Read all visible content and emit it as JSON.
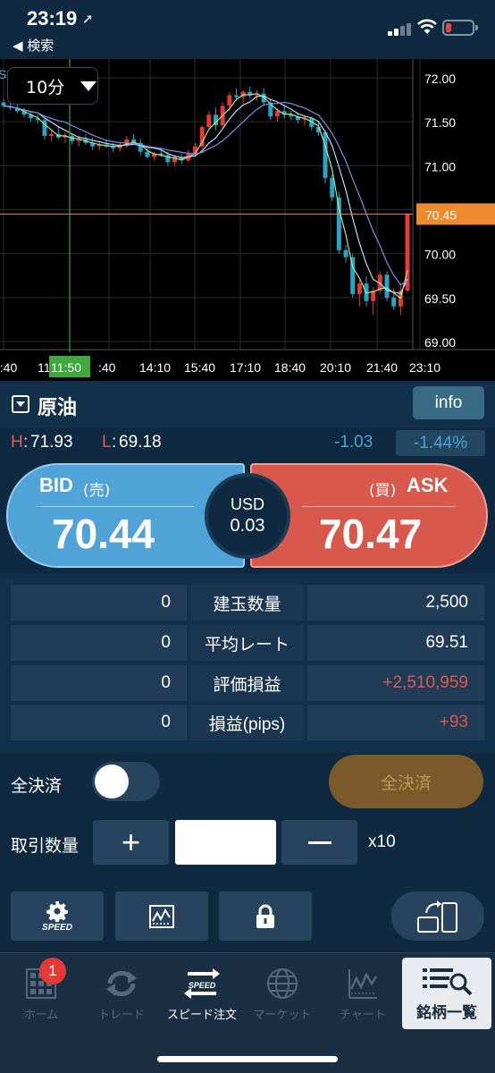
{
  "status_bar": {
    "time": "23:19",
    "back_label": "◀ 検索"
  },
  "chart": {
    "interval": "10分",
    "sma_label": "SMA:5  SMA:25",
    "current_price_tag": "70.45",
    "crosshair_time": "11:50",
    "colors": {
      "up": "#e53935",
      "down": "#26a5c8",
      "sma_short": "#a6e98a",
      "sma_mid": "#b8dcf8",
      "sma_long": "#7a8fe8",
      "price_tag": "#f08a2e",
      "crosshair": "#3fbf3f"
    }
  },
  "chart_data": {
    "type": "candlestick",
    "y_ticks": [
      "72.00",
      "71.50",
      "71.00",
      "70.50",
      "70.00",
      "69.50",
      "69.00"
    ],
    "ylim": [
      69.0,
      72.0
    ],
    "x_ticks": [
      "9:40",
      "11",
      "11:50",
      ":40",
      "14:10",
      "15:40",
      "17:10",
      "18:40",
      "20:10",
      "21:40",
      "23:10"
    ],
    "candles": [
      [
        71.72,
        71.76,
        71.66,
        71.68
      ],
      [
        71.68,
        71.72,
        71.63,
        71.66
      ],
      [
        71.66,
        71.7,
        71.6,
        71.62
      ],
      [
        71.62,
        71.66,
        71.55,
        71.58
      ],
      [
        71.58,
        71.62,
        71.5,
        71.54
      ],
      [
        71.54,
        71.58,
        71.48,
        71.52
      ],
      [
        71.52,
        71.54,
        71.3,
        71.34
      ],
      [
        71.34,
        71.4,
        71.28,
        71.36
      ],
      [
        71.36,
        71.44,
        71.3,
        71.32
      ],
      [
        71.32,
        71.38,
        71.26,
        71.34
      ],
      [
        71.34,
        71.36,
        71.24,
        71.28
      ],
      [
        71.28,
        71.34,
        71.22,
        71.3
      ],
      [
        71.3,
        71.36,
        71.24,
        71.26
      ],
      [
        71.26,
        71.32,
        71.18,
        71.22
      ],
      [
        71.22,
        71.28,
        71.18,
        71.24
      ],
      [
        71.24,
        71.3,
        71.2,
        71.22
      ],
      [
        71.22,
        71.26,
        71.16,
        71.2
      ],
      [
        71.2,
        71.26,
        71.16,
        71.24
      ],
      [
        71.24,
        71.34,
        71.2,
        71.3
      ],
      [
        71.3,
        71.36,
        71.24,
        71.26
      ],
      [
        71.26,
        71.3,
        71.12,
        71.16
      ],
      [
        71.16,
        71.22,
        71.08,
        71.1
      ],
      [
        71.1,
        71.16,
        71.06,
        71.14
      ],
      [
        71.14,
        71.2,
        71.1,
        71.12
      ],
      [
        71.12,
        71.16,
        71.0,
        71.04
      ],
      [
        71.04,
        71.12,
        71.0,
        71.1
      ],
      [
        71.1,
        71.14,
        71.02,
        71.06
      ],
      [
        71.06,
        71.18,
        71.04,
        71.14
      ],
      [
        71.14,
        71.26,
        71.1,
        71.22
      ],
      [
        71.22,
        71.46,
        71.18,
        71.44
      ],
      [
        71.44,
        71.62,
        71.4,
        71.58
      ],
      [
        71.58,
        71.66,
        71.4,
        71.46
      ],
      [
        71.46,
        71.72,
        71.42,
        71.68
      ],
      [
        71.68,
        71.84,
        71.62,
        71.8
      ],
      [
        71.8,
        71.88,
        71.74,
        71.78
      ],
      [
        71.78,
        71.86,
        71.7,
        71.84
      ],
      [
        71.84,
        71.9,
        71.76,
        71.8
      ],
      [
        71.8,
        71.86,
        71.74,
        71.82
      ],
      [
        71.82,
        71.88,
        71.68,
        71.72
      ],
      [
        71.72,
        71.76,
        71.52,
        71.56
      ],
      [
        71.56,
        71.66,
        71.5,
        71.62
      ],
      [
        71.62,
        71.68,
        71.54,
        71.58
      ],
      [
        71.58,
        71.62,
        71.52,
        71.56
      ],
      [
        71.56,
        71.6,
        71.48,
        71.52
      ],
      [
        71.52,
        71.58,
        71.46,
        71.54
      ],
      [
        71.54,
        71.56,
        71.4,
        71.44
      ],
      [
        71.44,
        71.5,
        71.34,
        71.38
      ],
      [
        71.38,
        71.4,
        70.8,
        70.86
      ],
      [
        70.86,
        70.9,
        70.6,
        70.64
      ],
      [
        70.64,
        70.7,
        70.0,
        70.04
      ],
      [
        70.04,
        70.1,
        69.9,
        69.96
      ],
      [
        69.96,
        70.0,
        69.5,
        69.54
      ],
      [
        69.54,
        69.7,
        69.4,
        69.66
      ],
      [
        69.66,
        69.74,
        69.4,
        69.46
      ],
      [
        69.46,
        69.62,
        69.3,
        69.58
      ],
      [
        69.58,
        69.8,
        69.54,
        69.76
      ],
      [
        69.76,
        69.8,
        69.46,
        69.5
      ],
      [
        69.5,
        69.6,
        69.36,
        69.4
      ],
      [
        69.4,
        69.66,
        69.3,
        69.58
      ],
      [
        69.58,
        70.46,
        69.56,
        70.45
      ]
    ],
    "series": [
      {
        "name": "SMA:5"
      },
      {
        "name": "SMA:25"
      }
    ]
  },
  "instrument": {
    "name": "原油",
    "info_label": "info",
    "high_label": "H",
    "high": "71.93",
    "low_label": "L",
    "low": "69.18",
    "change": "-1.03",
    "change_pct": "-1.44%"
  },
  "quote": {
    "bid_label": "BID",
    "bid_sub": "(売)",
    "bid": "70.44",
    "ask_sub": "(買)",
    "ask_label": "ASK",
    "ask": "70.47",
    "currency": "USD",
    "spread": "0.03"
  },
  "positions": [
    {
      "left": "0",
      "label": "建玉数量",
      "right": "2,500",
      "right_color": "white"
    },
    {
      "left": "0",
      "label": "平均レート",
      "right": "69.51",
      "right_color": "white"
    },
    {
      "left": "0",
      "label": "評価損益",
      "right": "+2,510,959",
      "right_color": "red"
    },
    {
      "left": "0",
      "label": "損益(pips)",
      "right": "+93",
      "right_color": "red"
    }
  ],
  "settle": {
    "label": "全決済",
    "toggle_on": false,
    "button_label": "全決済"
  },
  "quantity": {
    "label": "取引数量",
    "value": "",
    "multiplier": "x10"
  },
  "tools": {
    "speed_label": "SPEED"
  },
  "tab_bar": {
    "home": "ホーム",
    "trade": "トレード",
    "speed": "スピード注文",
    "market": "マーケット",
    "chart": "チャート",
    "list": "銘柄一覧",
    "badge_count": "1",
    "speed_icon_text": "SPEED"
  }
}
